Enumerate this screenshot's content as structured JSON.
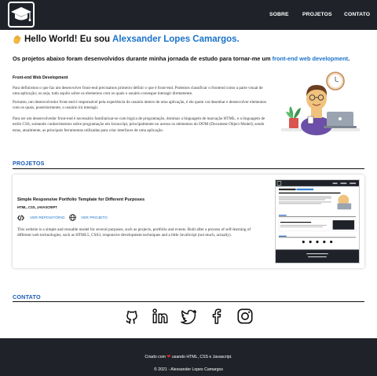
{
  "header": {
    "logo_icon": "graduation-cap-icon",
    "nav": [
      "SOBRE",
      "PROJETOS",
      "CONTATO"
    ]
  },
  "intro": {
    "greeting": "Hello World! Eu sou ",
    "name": "Alexsander Lopes Camargos.",
    "subtitle_prefix": "Os projetos abaixo foram desenvolvidos durante minha jornada de estudo para tornar-me um ",
    "subtitle_link": "front-end web development",
    "subtitle_suffix": "."
  },
  "about": {
    "title": "Front-end Web Development",
    "paragraphs": [
      "Para definirmos o que faz um desenvolver front-end precisamos primeiro definir o que é front-end. Podemos classificar o frontend como a parte visual de uma aplicação; ou seja, tudo aquilo sobre os elementos com os quais o usuário consegue interagir diretamente.",
      "Portanto, um desenvolvedor front-end é responsável pela experiência do usuário dentro de uma aplicação, é ele quem vai desenhar e desenvolver elementos com os quais, posteriormente, o usuário irá interagir.",
      "Para ser um desenvolvedor front-end é necessário familiarizar-se com lógica de programação, dominar a linguagem de marcação HTML, e a linguagem de estilo CSS, somando conhecimentos sobre programação em Javascript, principalmente no acesso os elementos do DOM (Document Object Model); sendo estas, atualmente, as principais ferramentas utilizadas para criar interfaces de uma aplicação."
    ]
  },
  "projects": {
    "section_title": "PROJETOS",
    "items": [
      {
        "title": "Simple Responsive Portfolio Template for Different Purposes",
        "tech": "HTML, CSS, JAVASCRIPT",
        "repo_label": "VER REPOSITÓRIO",
        "project_label": "VER PROJETO",
        "description": "This website is a simple and reusable model for several purposes, such as projects, portfolio and events. Built after a process of self-learning of different web technologies, such as HTML5, CSS3, responsive development techniques and a little JavaScript (not much, actually)."
      }
    ]
  },
  "contact": {
    "section_title": "CONTATO",
    "icons": [
      "github-icon",
      "linkedin-icon",
      "twitter-icon",
      "facebook-icon",
      "instagram-icon"
    ]
  },
  "footer": {
    "credits_prefix": "Criado com ",
    "credits_suffix": " usando HTML, CSS e Javascript.",
    "heart": "❤",
    "copyright": "© 2021 - Alexsander Lopes Camargos"
  },
  "colors": {
    "dark": "#1f2329",
    "accent_blue": "#1a73c9",
    "section_blue": "#1a5bb5",
    "heart": "#e0262b"
  }
}
